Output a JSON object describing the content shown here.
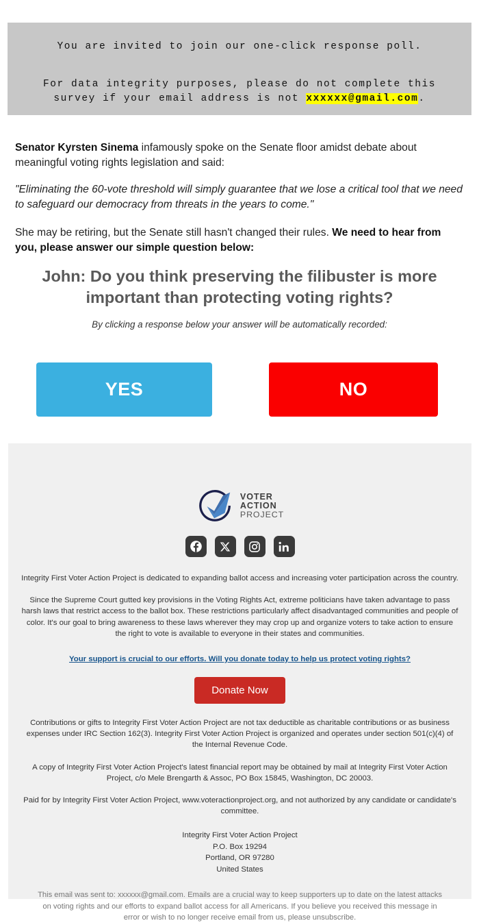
{
  "notice": {
    "line1": "You are invited to join our one-click response poll.",
    "line2_before": "For data integrity purposes, please do not complete this survey if your email address is not ",
    "line2_email": "xxxxxx@gmail.com",
    "line2_after": ".",
    "highlight_color": "#ffff00",
    "background_color": "#c7c7c7"
  },
  "body": {
    "p1_bold": "Senator Kyrsten Sinema",
    "p1_rest": " infamously spoke on the Senate floor amidst debate about meaningful voting rights legislation and said:",
    "quote": "\"Eliminating the 60-vote threshold will simply guarantee that we lose a critical tool that we need to safeguard our democracy from threats in the years to come.\"",
    "p3_rest": "She may be retiring, but the Senate still hasn't changed their rules. ",
    "p3_bold": "We need to hear from you, please answer our simple question below:"
  },
  "poll": {
    "question": "John: Do you think preserving the filibuster is more important than protecting voting rights?",
    "subnote": "By clicking a response below your answer will be automatically recorded:",
    "yes_label": "YES",
    "no_label": "NO",
    "yes_color": "#3bb0e0",
    "no_color": "#fa0000"
  },
  "footer": {
    "logo": {
      "line1": "VOTER",
      "line2": "ACTION",
      "line3": "PROJECT",
      "circle_color": "#1b1f4b",
      "check_color": "#4a86c8"
    },
    "social": [
      {
        "name": "facebook",
        "label": "Facebook"
      },
      {
        "name": "x-twitter",
        "label": "X"
      },
      {
        "name": "instagram",
        "label": "Instagram"
      },
      {
        "name": "linkedin",
        "label": "LinkedIn"
      }
    ],
    "mission": "Integrity First Voter Action Project is dedicated to expanding ballot access and increasing voter participation across the country.",
    "story": "Since the Supreme Court gutted key provisions in the Voting Rights Act, extreme politicians have taken advantage to pass harsh laws that restrict access to the ballot box. These restrictions particularly affect disadvantaged communities and people of color. It's our goal to bring awareness to these laws wherever they may crop up and organize voters to take action to ensure the right to vote is available to everyone in their states and communities.",
    "donate_link": "Your support is crucial to our efforts. Will you donate today to help us protect voting rights?",
    "donate_link_color": "#18558c",
    "donate_button": "Donate Now",
    "donate_button_color": "#c92a24",
    "legal1": "Contributions or gifts to Integrity First Voter Action Project are not tax deductible as charitable contributions or as business expenses under IRC Section 162(3). Integrity First Voter Action Project is organized and operates under section 501(c)(4) of the Internal Revenue Code.",
    "legal2": "A copy of Integrity First Voter Action Project's latest financial report may be obtained by mail at Integrity First Voter Action Project, c/o Mele Brengarth & Assoc, PO Box 15845, Washington, DC 20003.",
    "legal3": "Paid for by Integrity First Voter Action Project, www.voteractionproject.org, and not authorized by any candidate or candidate's committee.",
    "address": {
      "org": "Integrity First Voter Action Project",
      "street": "P.O. Box 19294",
      "city": "Portland, OR 97280",
      "country": "United States"
    },
    "sent_note": "This email was sent to: xxxxxx@gmail.com. Emails are a crucial way to keep supporters up to date on the latest attacks on voting rights and our efforts to expand ballot access for all Americans. If you believe you received this message in error or wish to no longer receive email from us, please unsubscribe."
  }
}
